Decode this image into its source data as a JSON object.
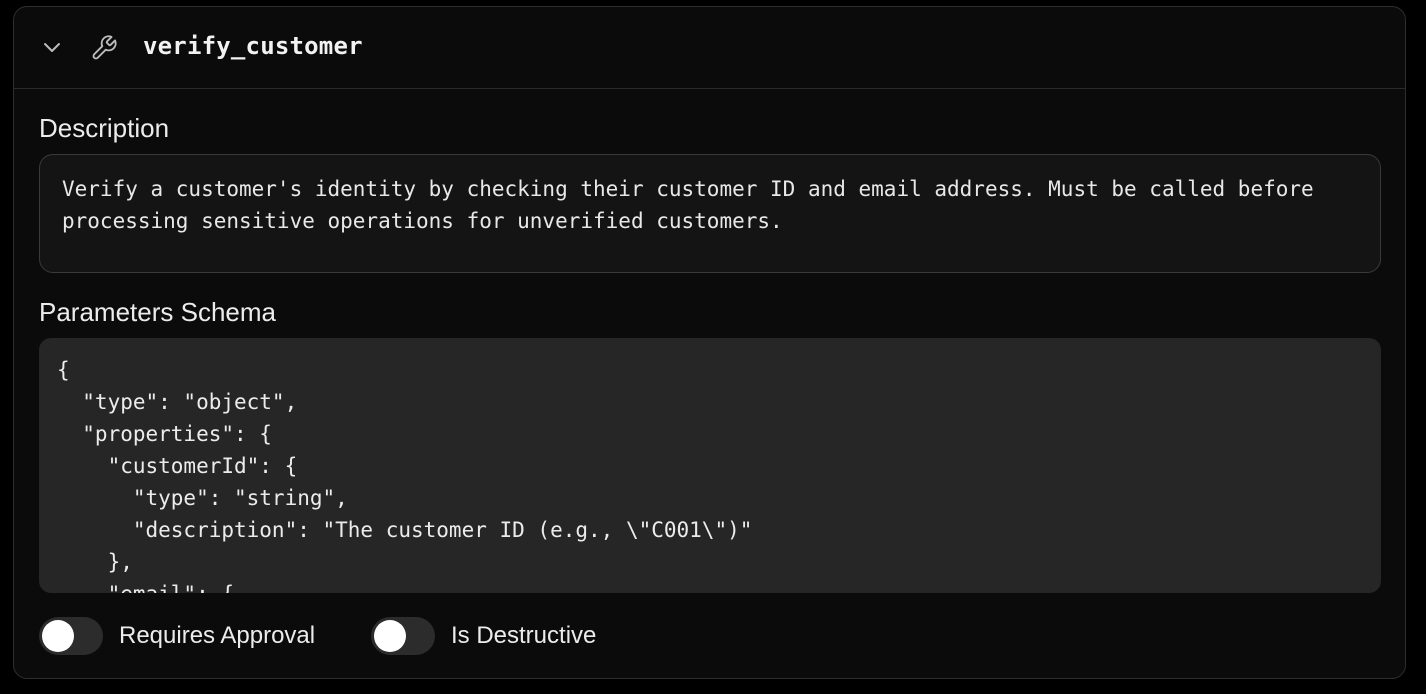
{
  "tool": {
    "name": "verify_customer",
    "expanded": true
  },
  "description": {
    "label": "Description",
    "value": "Verify a customer's identity by checking their customer ID and email address. Must be called before processing sensitive operations for unverified customers."
  },
  "schema": {
    "label": "Parameters Schema",
    "code": "{\n  \"type\": \"object\",\n  \"properties\": {\n    \"customerId\": {\n      \"type\": \"string\",\n      \"description\": \"The customer ID (e.g., \\\"C001\\\")\"\n    },\n    \"email\": {"
  },
  "toggles": {
    "requires_approval": {
      "label": "Requires Approval",
      "on": false
    },
    "is_destructive": {
      "label": "Is Destructive",
      "on": false
    }
  },
  "icons": {
    "collapse": "chevron-down-icon",
    "tool": "wrench-icon"
  },
  "colors": {
    "background": "#000000",
    "panel": "#0b0b0b",
    "code_bg": "#262626",
    "text": "#ececec"
  }
}
